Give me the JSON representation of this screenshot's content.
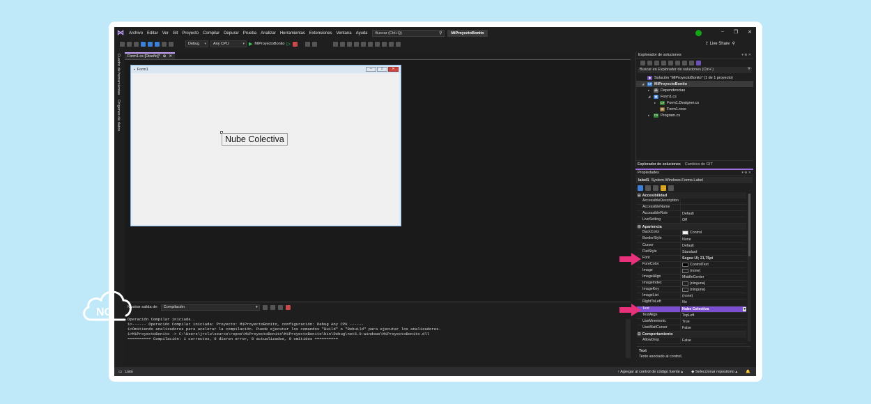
{
  "menubar": {
    "items": [
      "Archivo",
      "Editar",
      "Ver",
      "Git",
      "Proyecto",
      "Compilar",
      "Depurar",
      "Prueba",
      "Analizar",
      "Herramientas",
      "Extensiones",
      "Ventana",
      "Ayuda"
    ],
    "search_placeholder": "Buscar (Ctrl+Q)",
    "project_name": "MiProyectoBonito",
    "live_share": "Live Share"
  },
  "toolbar": {
    "config": "Debug",
    "platform": "Any CPU",
    "run_target": "MiProyectoBonito"
  },
  "left_strip": {
    "toolbox": "Cuadro de herramientas",
    "data_sources": "Orígenes de datos"
  },
  "editor": {
    "tab_label": "Form1.cs [Diseño]*",
    "form_title": "Form1",
    "label_text": "Nube Colectiva"
  },
  "output": {
    "title": "Salida",
    "show_from_label": "Mostrar salida de:",
    "source": "Compilación",
    "lines": [
      "Operación Compilar iniciada..",
      "1>------ Operación Compilar iniciada: Proyecto: MiProyectoBonito, configuración: Debug Any CPU ------",
      "1>Omitiendo analizadores para acelerar la compilación. Puede ejecutar los comandos \"Build\" o \"Rebuild\" para ejecutar los analizadores.",
      "1>MiProyectoBonito -> C:\\Users\\jrclu\\source\\repos\\MiProyectoBonito\\MiProyectoBonito\\bin\\Debug\\net6.0-windows\\MiProyectoBonito.dll",
      "========== Compilación: 1 correctos, 0 dieron error, 0 actualizados, 0 omitidos =========="
    ]
  },
  "solution_explorer": {
    "title": "Explorador de soluciones",
    "search_placeholder": "Buscar en Explorador de soluciones (Ctrl+')",
    "tree": [
      {
        "label": "Solución \"MiProyectoBonito\" (1 de 1 proyecto)",
        "icon": "solution-icon",
        "indent": 0
      },
      {
        "label": "MiProyectoBonito",
        "icon": "project-icon",
        "indent": 0
      },
      {
        "label": "Dependencias",
        "icon": "dependencies-icon",
        "indent": 1
      },
      {
        "label": "Form1.cs",
        "icon": "form-icon",
        "indent": 1
      },
      {
        "label": "Form1.Designer.cs",
        "icon": "csharp-file-icon",
        "indent": 2
      },
      {
        "label": "Form1.resx",
        "icon": "resx-file-icon",
        "indent": 2
      },
      {
        "label": "Program.cs",
        "icon": "csharp-file-icon",
        "indent": 1
      }
    ],
    "tabs": [
      "Explorador de soluciones",
      "Cambios de GIT"
    ]
  },
  "properties": {
    "title": "Propiedades",
    "object_name": "label1",
    "object_type": "System.Windows.Forms.Label",
    "categories": [
      {
        "name": "Accesibilidad",
        "rows": [
          {
            "name": "AccessibleDescription",
            "value": ""
          },
          {
            "name": "AccessibleName",
            "value": ""
          },
          {
            "name": "AccessibleRole",
            "value": "Default"
          },
          {
            "name": "LiveSetting",
            "value": "Off"
          }
        ]
      },
      {
        "name": "Apariencia",
        "rows": [
          {
            "name": "BackColor",
            "value": "Control",
            "swatch": "#f0f0f0"
          },
          {
            "name": "BorderStyle",
            "value": "None"
          },
          {
            "name": "Cursor",
            "value": "Default"
          },
          {
            "name": "FlatStyle",
            "value": "Standard"
          },
          {
            "name": "Font",
            "value": "Segoe UI; 21,75pt",
            "bold": true
          },
          {
            "name": "ForeColor",
            "value": "ControlText",
            "swatch": "#000000"
          },
          {
            "name": "Image",
            "value": "(none)",
            "swatch": "#1f1f1f"
          },
          {
            "name": "ImageAlign",
            "value": "MiddleCenter"
          },
          {
            "name": "ImageIndex",
            "value": "(ninguna)",
            "swatch": "#1f1f1f"
          },
          {
            "name": "ImageKey",
            "value": "(ninguna)",
            "swatch": "#1f1f1f"
          },
          {
            "name": "ImageList",
            "value": "(none)"
          },
          {
            "name": "RightToLeft",
            "value": "No"
          },
          {
            "name": "Text",
            "value": "Nube Colectiva",
            "bold": true,
            "selected": true
          },
          {
            "name": "TextAlign",
            "value": "TopLeft"
          },
          {
            "name": "UseMnemonic",
            "value": "True"
          },
          {
            "name": "UseWaitCursor",
            "value": "False"
          }
        ]
      },
      {
        "name": "Comportamiento",
        "rows": [
          {
            "name": "AllowDrop",
            "value": "False"
          }
        ]
      }
    ],
    "description_title": "Text",
    "description_text": "Texto asociado al control."
  },
  "statusbar": {
    "status": "Listo",
    "source_control": "Agregar al control de código fuente",
    "repo": "Seleccionar repositorio"
  },
  "logo": {
    "text": "NC"
  },
  "colors": {
    "accent_purple": "#7b4fd0",
    "arrow_pink": "#e8317a",
    "background": "#bfe8f8"
  }
}
